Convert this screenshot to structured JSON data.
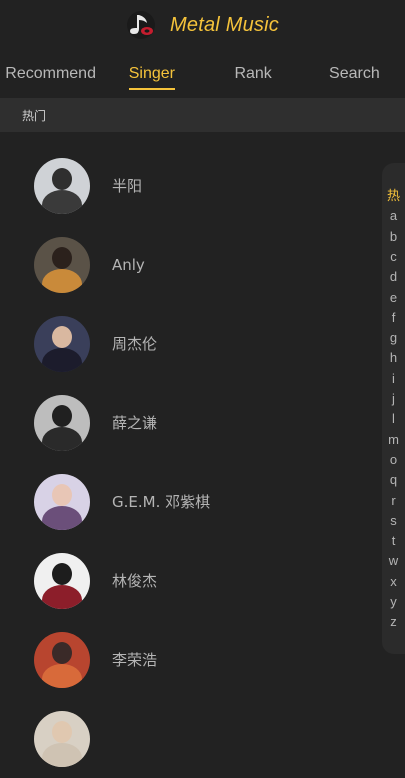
{
  "header": {
    "title": "Metal Music",
    "logo_icon": "music-note-icon"
  },
  "tabs": [
    {
      "label": "Recommend",
      "active": false
    },
    {
      "label": "Singer",
      "active": true
    },
    {
      "label": "Rank",
      "active": false
    },
    {
      "label": "Search",
      "active": false
    }
  ],
  "section": {
    "title": "热门"
  },
  "singers": [
    {
      "name": "半阳",
      "palette": [
        "#cfd2d6",
        "#2f2f2f",
        "#3a3a3a"
      ]
    },
    {
      "name": "Anly",
      "palette": [
        "#5a5247",
        "#2b211c",
        "#c98a3a"
      ]
    },
    {
      "name": "周杰伦",
      "palette": [
        "#3a3f5a",
        "#d9b8a0",
        "#1c1c2c"
      ]
    },
    {
      "name": "薛之谦",
      "palette": [
        "#bdbdbd",
        "#202020",
        "#2a2a2a"
      ]
    },
    {
      "name": "G.E.M. 邓紫棋",
      "palette": [
        "#d8d2e6",
        "#e8c6b6",
        "#6b4f7a"
      ]
    },
    {
      "name": "林俊杰",
      "palette": [
        "#f0f0f0",
        "#1d1d1d",
        "#8c1e2a"
      ]
    },
    {
      "name": "李荣浩",
      "palette": [
        "#b8452f",
        "#3a2a28",
        "#d86a3a"
      ]
    },
    {
      "name": "",
      "palette": [
        "#d8d0c4",
        "#e0c8b0",
        "#cfc3b3"
      ]
    }
  ],
  "index": {
    "letters": [
      "热",
      "a",
      "b",
      "c",
      "d",
      "e",
      "f",
      "g",
      "h",
      "i",
      "j",
      "l",
      "m",
      "o",
      "q",
      "r",
      "s",
      "t",
      "w",
      "x",
      "y",
      "z"
    ],
    "active": "热"
  },
  "colors": {
    "accent": "#f5c33b",
    "background": "#222222"
  }
}
